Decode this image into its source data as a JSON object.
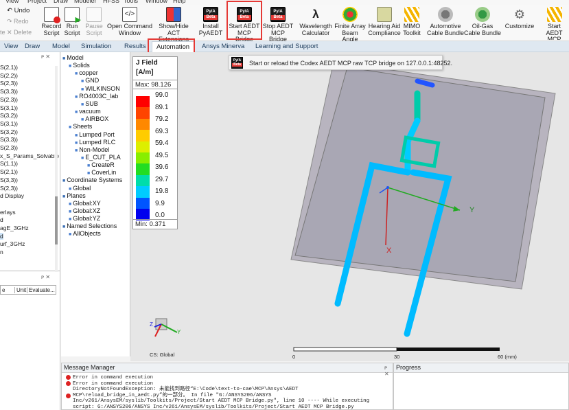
{
  "menubar": [
    "View",
    "Project",
    "Draw",
    "Modeler",
    "HFSS",
    "Tools",
    "Window",
    "Help"
  ],
  "ribbon": {
    "undo": "Undo",
    "redo": "Redo",
    "delete": "Delete",
    "paste": "te",
    "record": "Record\nScript",
    "run": "Run\nScript",
    "pause": "Pause\nScript",
    "open_cmd": "Open Command\nWindow",
    "show_hide": "Show/Hide\nACT Extensions",
    "install": "Install\nPyAEDT",
    "start_mcp": "Start AEDT\nMCP Bridge",
    "stop_mcp": "Stop AEDT\nMCP Bridge",
    "wavelength": "Wavelength\nCalculator",
    "finite_array": "Finite Array\nBeam Angle",
    "hearing_aid": "Hearing Aid\nCompliance",
    "mimo": "MIMO\nToolkit",
    "automotive": "Automotive\nCable Bundle",
    "oil_gas": "Oil-Gas\nCable Bundle",
    "customize": "Customize",
    "start_mcp2": "Start AEDT\nMCP Bridg",
    "py_top": "Py/A",
    "py_bottom": "Beta"
  },
  "tabs": [
    "View",
    "Draw",
    "Model",
    "Simulation",
    "Results",
    "Automation",
    "Ansys Minerva",
    "Learning and Support"
  ],
  "active_tab": "Automation",
  "tooltip": "Start or reload the Codex AEDT MCP raw TCP bridge on 127.0.0.1:48252.",
  "left_items": [
    "S(2,1))",
    "S(2,2))",
    "S(2,3))",
    "S(3,3))",
    "S(2,3))",
    "S(3,1))",
    "S(3,2))",
    "S(3,1))",
    "S(3,2))",
    "S(3,3))",
    "S(2,3))",
    "x_S_Params_Solvable",
    "S(1,1))",
    "S(2,1))",
    "S(3,3))",
    "S(2,3))",
    "d Display",
    "",
    "erlays",
    "d",
    "agE_3GHz",
    "d",
    "urf_3GHz",
    "n"
  ],
  "left_table": {
    "cols": [
      "e",
      "Unit",
      "Evaluate..."
    ]
  },
  "tree": [
    {
      "t": "Model",
      "d": 0
    },
    {
      "t": "Solids",
      "d": 1
    },
    {
      "t": "copper",
      "d": 2
    },
    {
      "t": "GND",
      "d": 3
    },
    {
      "t": "WILKINSON",
      "d": 3
    },
    {
      "t": "RO4003C_lab",
      "d": 2
    },
    {
      "t": "SUB",
      "d": 3
    },
    {
      "t": "vacuum",
      "d": 2
    },
    {
      "t": "AIRBOX",
      "d": 3
    },
    {
      "t": "Sheets",
      "d": 1
    },
    {
      "t": "Lumped Port",
      "d": 2
    },
    {
      "t": "Lumped RLC",
      "d": 2
    },
    {
      "t": "Non-Model",
      "d": 2
    },
    {
      "t": "E_CUT_PLA",
      "d": 3
    },
    {
      "t": "CreateR",
      "d": 4
    },
    {
      "t": "CoverLin",
      "d": 4
    },
    {
      "t": "Coordinate Systems",
      "d": 0
    },
    {
      "t": "Global",
      "d": 1
    },
    {
      "t": "Planes",
      "d": 0
    },
    {
      "t": "Global:XY",
      "d": 1
    },
    {
      "t": "Global:XZ",
      "d": 1
    },
    {
      "t": "Global:YZ",
      "d": 1
    },
    {
      "t": "Named Selections",
      "d": 0
    },
    {
      "t": "AllObjects",
      "d": 1
    }
  ],
  "legend": {
    "title": "J Field",
    "unit": "[A/m]",
    "max": "Max: 98.126",
    "min": "Min:  0.371",
    "values": [
      "99.0",
      "89.1",
      "79.2",
      "69.3",
      "59.4",
      "49.5",
      "39.6",
      "29.7",
      "19.8",
      "9.9",
      "0.0"
    ],
    "colors": [
      "#ff0000",
      "#ff4400",
      "#ff8800",
      "#ffcc00",
      "#ddee00",
      "#88ee00",
      "#22dd22",
      "#00ddaa",
      "#00ccff",
      "#0055ff",
      "#0000ee"
    ]
  },
  "axes": {
    "y": "Y",
    "x": "X",
    "z": "Z",
    "cs": "CS: Global"
  },
  "scale": {
    "l0": "0",
    "l1": "30",
    "l2": "60 (mm)"
  },
  "messages": {
    "title": "Message Manager",
    "lines": [
      "Error in command execution",
      "Error in command execution",
      "DirectoryNotFoundException: 未能找到路径“E:\\Code\\text-to-cae\\MCP\\Ansys\\AEDT MCP\\reload_bridge_in_aedt.py”的一部分。 In file \"G:/ANSYS206/ANSYS Inc/v261/AnsysEM/syslib/Toolkits/Project/Start AEDT MCP Bridge.py\", line 10 ---- While executing script: G:/ANSYS206/ANSYS Inc/v261/AnsysEM/syslib/Toolkits/Project/Start AEDT MCP Bridge.py"
    ]
  },
  "progress": {
    "title": "Progress"
  }
}
